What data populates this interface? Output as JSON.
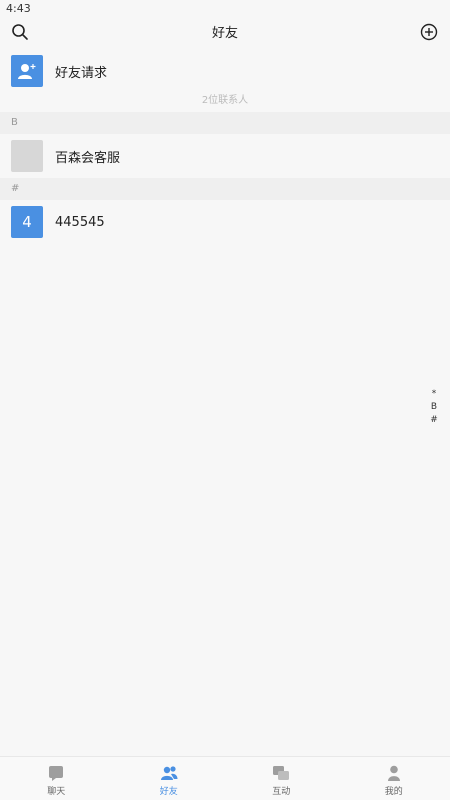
{
  "status": {
    "time": "4:43"
  },
  "nav": {
    "title": "好友",
    "left_icon": "search-icon",
    "right_icon": "add-circle-icon"
  },
  "friend_request": {
    "label": "好友请求",
    "icon": "add-user-icon"
  },
  "contacts_count": "2位联系人",
  "sections": [
    {
      "header": "B",
      "items": [
        {
          "label": "百森会客服",
          "avatar_text": ""
        }
      ]
    },
    {
      "header": "#",
      "items": [
        {
          "label": "445545",
          "avatar_text": "4"
        }
      ]
    }
  ],
  "index_bar": [
    "*",
    "B",
    "#"
  ],
  "tabs": [
    {
      "label": "聊天",
      "icon": "chat-icon"
    },
    {
      "label": "好友",
      "icon": "friends-icon"
    },
    {
      "label": "互动",
      "icon": "interaction-icon"
    },
    {
      "label": "我的",
      "icon": "profile-icon"
    }
  ],
  "colors": {
    "accent": "#4a90e2",
    "background": "#f7f7f7",
    "section_bg": "#efefef"
  }
}
